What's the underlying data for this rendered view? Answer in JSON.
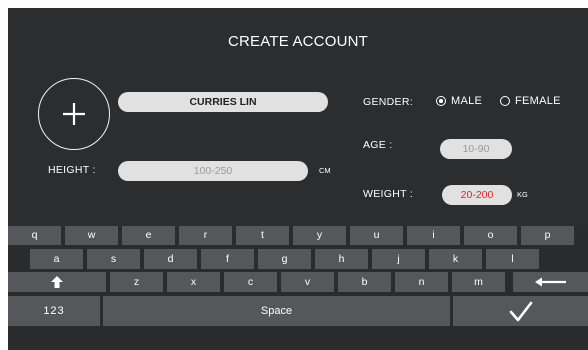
{
  "title": "CREATE ACCOUNT",
  "name": {
    "value": "CURRIES LIN"
  },
  "gender": {
    "label": "GENDER:",
    "options": [
      "MALE",
      "FEMALE"
    ],
    "selected": "MALE"
  },
  "age": {
    "label": "AGE :",
    "placeholder": "10-90"
  },
  "height": {
    "label": "HEIGHT :",
    "placeholder": "100-250",
    "unit": "CM"
  },
  "weight": {
    "label": "WEIGHT :",
    "value": "20-200",
    "unit": "KG"
  },
  "keyboard": {
    "row1": [
      "q",
      "w",
      "e",
      "r",
      "t",
      "y",
      "u",
      "i",
      "o",
      "p"
    ],
    "row2": [
      "a",
      "s",
      "d",
      "f",
      "g",
      "h",
      "j",
      "k",
      "l"
    ],
    "row3": [
      "z",
      "x",
      "c",
      "v",
      "b",
      "n",
      "m"
    ],
    "numbers": "123",
    "space": "Space"
  },
  "colors": {
    "background": "#2c2d2f",
    "key": "#55575a",
    "field": "#e1e1e1",
    "error_text": "#e3262a"
  },
  "icons": [
    "add-photo-icon",
    "shift-icon",
    "backspace-icon",
    "checkmark-icon"
  ]
}
